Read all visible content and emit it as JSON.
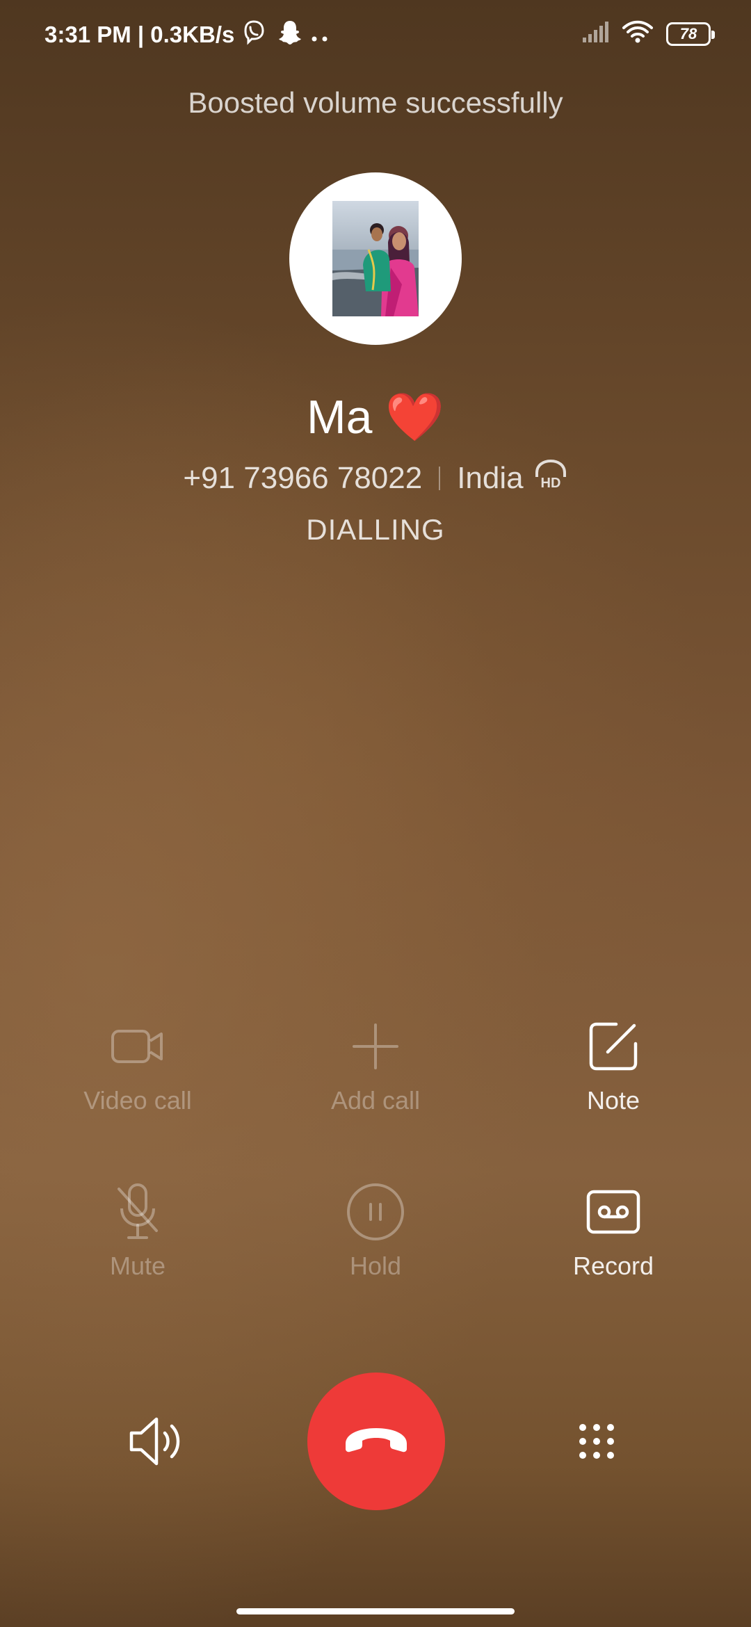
{
  "status_bar": {
    "time_and_speed": "3:31 PM | 0.3KB/s",
    "battery": "78",
    "icons": [
      "viber-icon",
      "snapchat-icon",
      "more-notifications-icon",
      "signal-icon",
      "wifi-icon",
      "battery-icon"
    ]
  },
  "toast": "Boosted volume successfully",
  "contact": {
    "name": "Ma",
    "emoji": "❤️",
    "number": "+91 73966 78022",
    "location": "India",
    "status": "DIALLING"
  },
  "actions": {
    "video_call": "Video call",
    "add_call": "Add call",
    "note": "Note",
    "mute": "Mute",
    "hold": "Hold",
    "record": "Record"
  },
  "colors": {
    "end_call": "#ee3a38",
    "heart": "#e8262c"
  }
}
